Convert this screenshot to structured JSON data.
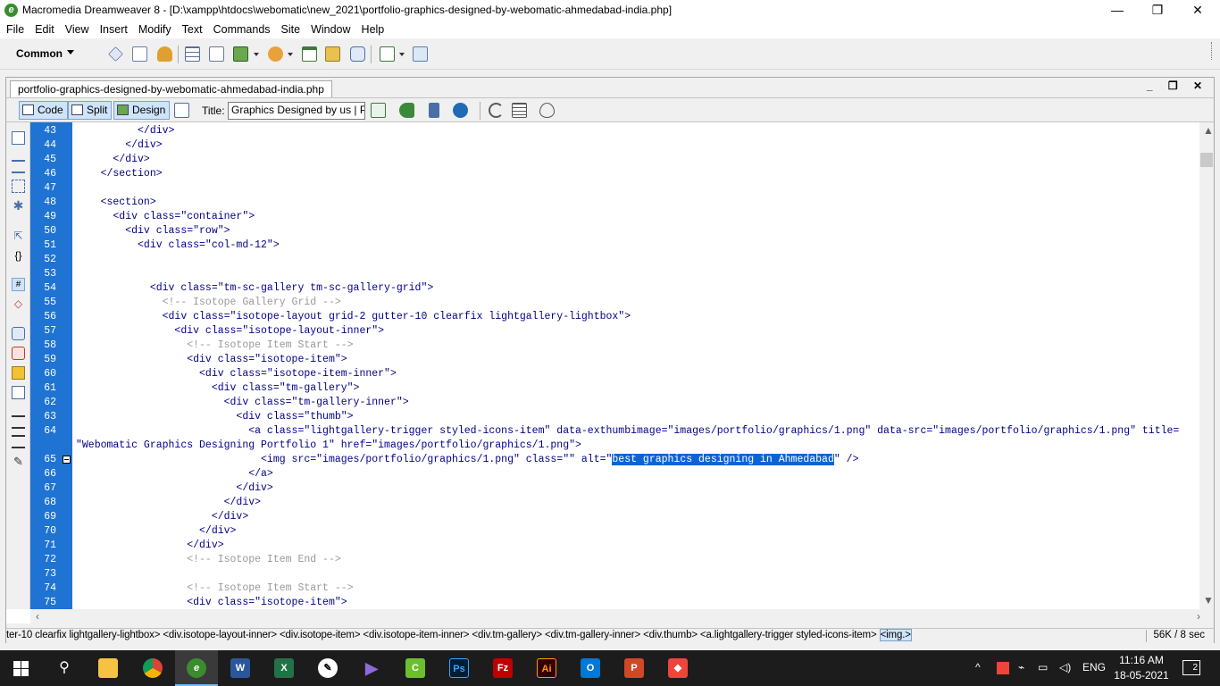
{
  "window": {
    "title": "Macromedia Dreamweaver 8 - [D:\\xampp\\htdocs\\webomatic\\new_2021\\portfolio-graphics-designed-by-webomatic-ahmedabad-india.php]",
    "minimize": "—",
    "restore": "❐",
    "close": "✕"
  },
  "menu": [
    "File",
    "Edit",
    "View",
    "Insert",
    "Modify",
    "Text",
    "Commands",
    "Site",
    "Window",
    "Help"
  ],
  "insert_bar": {
    "category": "Common"
  },
  "document": {
    "tab_label": "portfolio-graphics-designed-by-webomatic-ahmedabad-india.php",
    "window_controls": "_ ❐ ✕",
    "views": {
      "code": "Code",
      "split": "Split",
      "design": "Design"
    },
    "title_label": "Title:",
    "title_value": "Graphics Designed by us | Portfolio"
  },
  "code_lines": [
    {
      "n": "43",
      "text": "          </div>"
    },
    {
      "n": "44",
      "text": "        </div>"
    },
    {
      "n": "45",
      "text": "      </div>"
    },
    {
      "n": "46",
      "text": "    </section>"
    },
    {
      "n": "47",
      "text": ""
    },
    {
      "n": "48",
      "text": "    <section>"
    },
    {
      "n": "49",
      "text": "      <div class=\"container\">"
    },
    {
      "n": "50",
      "text": "        <div class=\"row\">"
    },
    {
      "n": "51",
      "text": "          <div class=\"col-md-12\">"
    },
    {
      "n": "52",
      "text": ""
    },
    {
      "n": "53",
      "text": ""
    },
    {
      "n": "54",
      "text": "            <div class=\"tm-sc-gallery tm-sc-gallery-grid\">"
    },
    {
      "n": "55",
      "text": "              <!-- Isotope Gallery Grid -->",
      "comment": true
    },
    {
      "n": "56",
      "text": "              <div class=\"isotope-layout grid-2 gutter-10 clearfix lightgallery-lightbox\">"
    },
    {
      "n": "57",
      "text": "                <div class=\"isotope-layout-inner\">"
    },
    {
      "n": "58",
      "text": "                  <!-- Isotope Item Start -->",
      "comment": true
    },
    {
      "n": "59",
      "text": "                  <div class=\"isotope-item\">"
    },
    {
      "n": "60",
      "text": "                    <div class=\"isotope-item-inner\">"
    },
    {
      "n": "61",
      "text": "                      <div class=\"tm-gallery\">"
    },
    {
      "n": "62",
      "text": "                        <div class=\"tm-gallery-inner\">"
    },
    {
      "n": "63",
      "text": "                          <div class=\"thumb\">"
    },
    {
      "n": "64",
      "text": "                            <a class=\"lightgallery-trigger styled-icons-item\" data-exthumbimage=\"images/portfolio/graphics/1.png\" data-src=\"images/portfolio/graphics/1.png\" title="
    },
    {
      "n": "",
      "text": "\"Webomatic Graphics Designing Portfolio 1\" href=\"images/portfolio/graphics/1.png\">"
    },
    {
      "n": "65",
      "text": "                              <img src=\"images/portfolio/graphics/1.png\" class=\"\" alt=\"",
      "highlight": "best graphics designing in Ahmedabad",
      "after": "\" />",
      "fold": true
    },
    {
      "n": "66",
      "text": "                            </a>"
    },
    {
      "n": "67",
      "text": "                          </div>"
    },
    {
      "n": "68",
      "text": "                        </div>"
    },
    {
      "n": "69",
      "text": "                      </div>"
    },
    {
      "n": "70",
      "text": "                    </div>"
    },
    {
      "n": "71",
      "text": "                  </div>"
    },
    {
      "n": "72",
      "text": "                  <!-- Isotope Item End -->",
      "comment": true
    },
    {
      "n": "73",
      "text": ""
    },
    {
      "n": "74",
      "text": "                  <!-- Isotope Item Start -->",
      "comment": true
    },
    {
      "n": "75",
      "text": "                  <div class=\"isotope-item\">"
    }
  ],
  "status": {
    "tag_selector": "ter-10 clearfix lightgallery-lightbox> <div.isotope-layout-inner> <div.isotope-item> <div.isotope-item-inner> <div.tm-gallery> <div.tm-gallery-inner> <div.thumb> <a.lightgallery-trigger styled-icons-item> ",
    "selected_tag": "<img.>",
    "doc_size": "56K / 8 sec"
  },
  "taskbar": {
    "lang": "ENG",
    "time": "11:16 AM",
    "date": "18-05-2021",
    "notifications": "2"
  },
  "colors": {
    "gutter": "#1e73d3",
    "code_text": "#000088",
    "comment": "#999999",
    "selection": "#0a64d6"
  }
}
